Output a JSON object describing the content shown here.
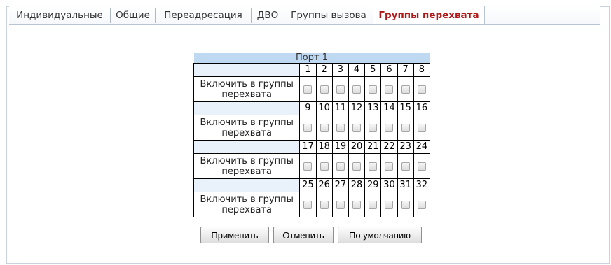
{
  "tabs": [
    {
      "label": "Индивидуальные",
      "active": false
    },
    {
      "label": "Общие",
      "active": false
    },
    {
      "label": "Переадресация",
      "active": false
    },
    {
      "label": "ДВО",
      "active": false
    },
    {
      "label": "Группы вызова",
      "active": false
    },
    {
      "label": "Группы перехвата",
      "active": true
    }
  ],
  "port_header": "Порт 1",
  "row_label": "Включить в группы перехвата",
  "rows": [
    {
      "ports": [
        "1",
        "2",
        "3",
        "4",
        "5",
        "6",
        "7",
        "8"
      ]
    },
    {
      "ports": [
        "9",
        "10",
        "11",
        "12",
        "13",
        "14",
        "15",
        "16"
      ]
    },
    {
      "ports": [
        "17",
        "18",
        "19",
        "20",
        "21",
        "22",
        "23",
        "24"
      ]
    },
    {
      "ports": [
        "25",
        "26",
        "27",
        "28",
        "29",
        "30",
        "31",
        "32"
      ]
    }
  ],
  "buttons": {
    "apply": "Применить",
    "cancel": "Отменить",
    "default": "По умолчанию"
  },
  "colors": {
    "active_tab_text": "#b21818",
    "header_bg": "#c0d9f2"
  }
}
